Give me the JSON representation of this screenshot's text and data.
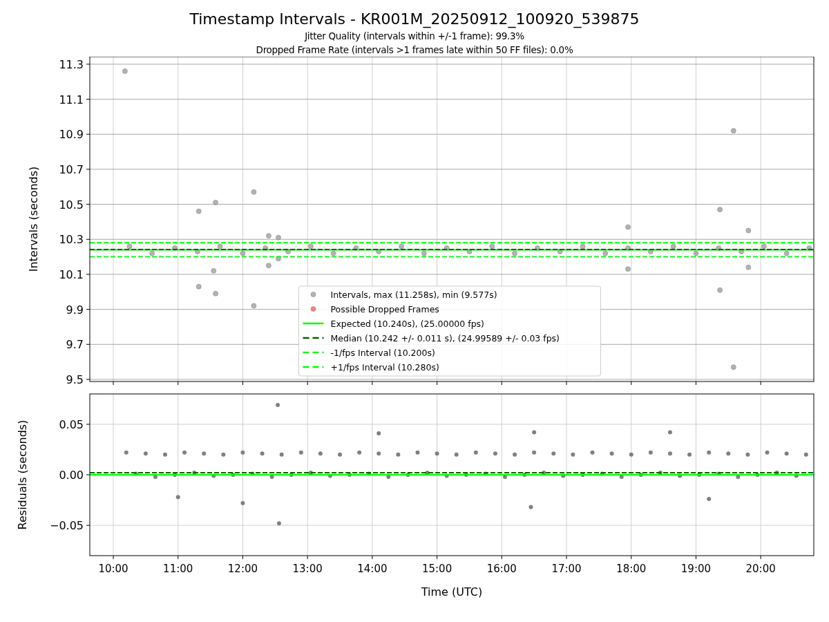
{
  "figure": {
    "title": "Timestamp Intervals - KR001M_20250912_100920_539875",
    "subtitles": [
      "Jitter Quality (intervals within +/-1 frame): 99.3%",
      "Dropped Frame Rate (intervals >1 frames late within 50 FF files): 0.0%"
    ]
  },
  "intervals_plot": {
    "chart_data": {
      "type": "scatter",
      "ylabel": "Intervals (seconds)",
      "xlim": [
        9.637,
        20.82
      ],
      "ylim": [
        9.488,
        11.343
      ],
      "grid": true,
      "legend": true,
      "yticks": [
        {
          "value": 9.5,
          "label": "9.5"
        },
        {
          "value": 9.7,
          "label": "9.7"
        },
        {
          "value": 9.9,
          "label": "9.9"
        },
        {
          "value": 10.1,
          "label": "10.1"
        },
        {
          "value": 10.3,
          "label": "10.3"
        },
        {
          "value": 10.5,
          "label": "10.5"
        },
        {
          "value": 10.7,
          "label": "10.7"
        },
        {
          "value": 10.9,
          "label": "10.9"
        },
        {
          "value": 11.1,
          "label": "11.1"
        },
        {
          "value": 11.3,
          "label": "11.3"
        }
      ],
      "series": [
        {
          "name": "Intervals, max (11.258s), min (9.577s)",
          "type": "scatter",
          "color": "#999999",
          "x": [
            10.18,
            11.32,
            11.32,
            11.58,
            11.58,
            11.55,
            12.17,
            12.17,
            12.4,
            12.4,
            12.55,
            12.55,
            17.95,
            17.95,
            19.37,
            19.37,
            19.58,
            19.58,
            19.81,
            19.81,
            10.25,
            10.6,
            10.95,
            11.3,
            11.65,
            12.0,
            12.35,
            12.7,
            13.05,
            13.4,
            13.75,
            14.1,
            14.45,
            14.8,
            15.15,
            15.5,
            15.85,
            16.2,
            16.55,
            16.9,
            17.25,
            17.6,
            17.95,
            18.3,
            18.65,
            19.0,
            19.35,
            19.7,
            20.05,
            20.4,
            20.75
          ],
          "values": [
            11.26,
            10.46,
            10.03,
            10.51,
            9.99,
            10.12,
            10.57,
            9.92,
            10.32,
            10.15,
            10.31,
            10.19,
            10.37,
            10.13,
            10.47,
            10.01,
            10.92,
            9.57,
            10.35,
            10.14,
            10.26,
            10.22,
            10.25,
            10.23,
            10.26,
            10.22,
            10.25,
            10.23,
            10.26,
            10.22,
            10.25,
            10.23,
            10.26,
            10.22,
            10.25,
            10.23,
            10.26,
            10.22,
            10.25,
            10.23,
            10.26,
            10.22,
            10.25,
            10.23,
            10.26,
            10.22,
            10.25,
            10.23,
            10.26,
            10.22,
            10.25
          ]
        },
        {
          "name": "Possible Dropped Frames",
          "type": "scatter",
          "color": "#ff5555"
        },
        {
          "name": "Expected (10.240s), (25.00000 fps)",
          "type": "line",
          "line_style": "solid",
          "color": "#00ff00",
          "x": [
            9.637,
            20.82
          ],
          "values": [
            10.24,
            10.24
          ]
        },
        {
          "name": "Median (10.242 +/- 0.011 s), (24.99589 +/- 0.03 fps)",
          "type": "line",
          "line_style": "dashed",
          "color": "#006400",
          "x": [
            9.637,
            20.82
          ],
          "values": [
            10.242,
            10.242
          ]
        },
        {
          "name": "-1/fps Interval (10.200s)",
          "type": "line",
          "line_style": "dashed",
          "color": "#22ee22",
          "x": [
            9.637,
            20.82
          ],
          "values": [
            10.2,
            10.2
          ]
        },
        {
          "name": "+1/fps Interval (10.280s)",
          "type": "line",
          "line_style": "dashed",
          "color": "#00ff00",
          "x": [
            9.637,
            20.82
          ],
          "values": [
            10.28,
            10.28
          ]
        }
      ]
    }
  },
  "residuals_plot": {
    "chart_data": {
      "type": "scatter",
      "xlabel": "Time (UTC)",
      "ylabel": "Residuals (seconds)",
      "xlim": [
        9.637,
        20.82
      ],
      "ylim": [
        -0.08,
        0.08
      ],
      "grid": true,
      "xticks": [
        {
          "value": 10,
          "label": "10:00"
        },
        {
          "value": 11,
          "label": "11:00"
        },
        {
          "value": 12,
          "label": "12:00"
        },
        {
          "value": 13,
          "label": "13:00"
        },
        {
          "value": 14,
          "label": "14:00"
        },
        {
          "value": 15,
          "label": "15:00"
        },
        {
          "value": 16,
          "label": "16:00"
        },
        {
          "value": 17,
          "label": "17:00"
        },
        {
          "value": 18,
          "label": "18:00"
        },
        {
          "value": 19,
          "label": "19:00"
        },
        {
          "value": 20,
          "label": "20:00"
        }
      ],
      "yticks": [
        {
          "value": -0.05,
          "label": "−0.05"
        },
        {
          "value": 0,
          "label": "0.00"
        },
        {
          "value": 0.05,
          "label": "0.05"
        }
      ],
      "series": [
        {
          "type": "scatter",
          "color": "#808080",
          "x": [
            12.54,
            12.56,
            10.2,
            10.5,
            10.8,
            11.1,
            11.4,
            11.7,
            12.0,
            12.3,
            12.6,
            12.9,
            13.2,
            13.5,
            13.8,
            14.1,
            14.4,
            14.7,
            15.0,
            15.3,
            15.6,
            15.9,
            16.2,
            16.5,
            16.8,
            17.1,
            17.4,
            17.7,
            18.0,
            18.3,
            18.6,
            18.9,
            19.2,
            19.5,
            19.8,
            20.1,
            20.4,
            20.7,
            10.35,
            10.65,
            10.95,
            11.25,
            11.55,
            11.85,
            12.15,
            12.45,
            12.75,
            13.05,
            13.35,
            13.65,
            13.95,
            14.25,
            14.55,
            14.85,
            15.15,
            15.45,
            15.75,
            16.05,
            16.35,
            16.65,
            16.95,
            17.25,
            17.55,
            17.85,
            18.15,
            18.45,
            18.75,
            19.05,
            19.35,
            19.65,
            19.95,
            20.25,
            20.55,
            14.1,
            16.5,
            16.45,
            18.6,
            11.0,
            12.0,
            19.2
          ],
          "values": [
            0.069,
            -0.048,
            0.022,
            0.021,
            0.02,
            0.022,
            0.021,
            0.02,
            0.022,
            0.021,
            0.02,
            0.022,
            0.021,
            0.02,
            0.022,
            0.021,
            0.02,
            0.022,
            0.021,
            0.02,
            0.022,
            0.021,
            0.02,
            0.022,
            0.021,
            0.02,
            0.022,
            0.021,
            0.02,
            0.022,
            0.021,
            0.02,
            0.022,
            0.021,
            0.02,
            0.022,
            0.021,
            0.02,
            0.001,
            -0.002,
            0.0,
            0.002,
            -0.001,
            0.0,
            0.001,
            -0.002,
            0.0,
            0.002,
            -0.001,
            0.0,
            0.001,
            -0.002,
            0.0,
            0.002,
            -0.001,
            0.0,
            0.001,
            -0.002,
            0.0,
            0.002,
            -0.001,
            0.0,
            0.001,
            -0.002,
            0.0,
            0.002,
            -0.001,
            0.0,
            0.001,
            -0.002,
            0.0,
            0.002,
            -0.001,
            0.041,
            0.042,
            -0.032,
            0.042,
            -0.022,
            -0.028,
            -0.024
          ]
        },
        {
          "type": "line",
          "line_style": "solid",
          "color": "#00ff00",
          "x": [
            9.637,
            20.82
          ],
          "values": [
            0,
            0
          ]
        },
        {
          "type": "line",
          "line_style": "dashed",
          "color": "#006400",
          "x": [
            9.637,
            20.82
          ],
          "values": [
            0.002,
            0.002
          ]
        }
      ]
    }
  }
}
